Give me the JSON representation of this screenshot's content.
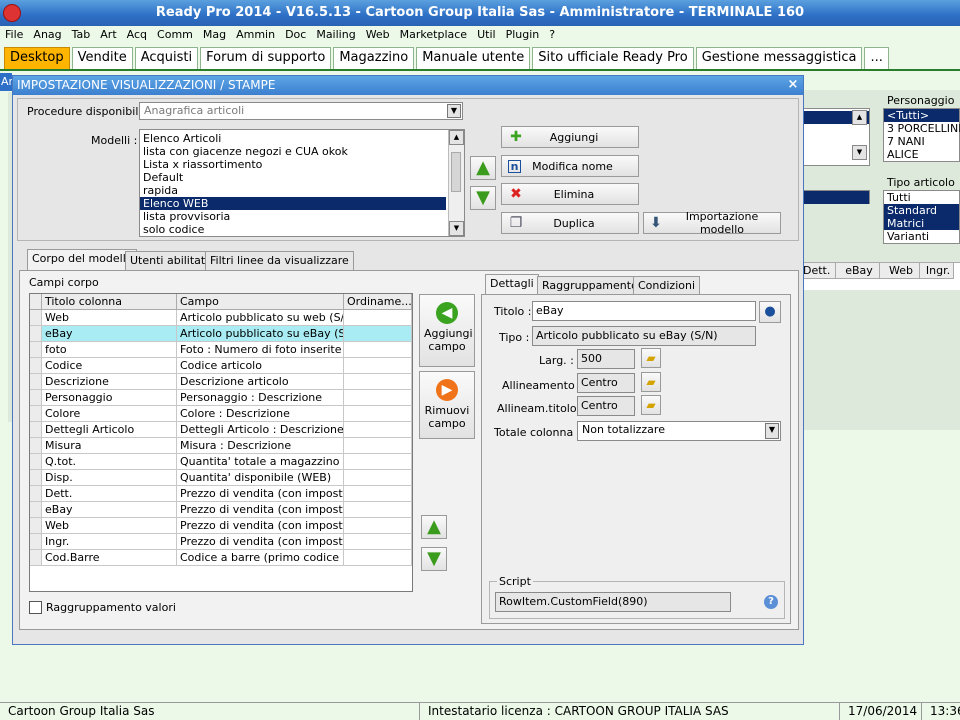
{
  "window": {
    "title": "Ready Pro 2014 - V16.5.13 - Cartoon Group Italia Sas - Amministratore - TERMINALE 160"
  },
  "menu": [
    "File",
    "Anag",
    "Tab",
    "Art",
    "Acq",
    "Comm",
    "Mag",
    "Ammin",
    "Doc",
    "Mailing",
    "Web",
    "Marketplace",
    "Util",
    "Plugin",
    "?"
  ],
  "tabs": [
    "Desktop",
    "Vendite",
    "Acquisti",
    "Forum di supporto",
    "Magazzino",
    "Manuale utente",
    "Sito ufficiale Ready Pro",
    "Gestione messaggistica",
    "..."
  ],
  "background": {
    "strip_label": "Ar",
    "personaggio": {
      "label": "Personaggio",
      "items": [
        "<Tutti>",
        "3 PORCELLINI",
        "7 NANI",
        "ALICE"
      ]
    },
    "tipo_articolo": {
      "label": "Tipo articolo",
      "items": [
        "Tutti",
        "Standard",
        "Matrici",
        "Varianti"
      ]
    },
    "grid_headers": [
      "Dett.",
      "eBay",
      "Web",
      "Ingr."
    ]
  },
  "dialog": {
    "title": "IMPOSTAZIONE VISUALIZZAZIONI / STAMPE",
    "close": "×",
    "procedure_label": "Procedure disponibili :",
    "procedure_value": "Anagrafica articoli",
    "modelli_label": "Modelli :",
    "modelli": [
      "Elenco Articoli",
      "lista con giacenze negozi e CUA okok",
      "Lista x riassortimento",
      "Default",
      "rapida",
      "Elenco WEB",
      "lista provvisoria",
      "solo codice"
    ],
    "buttons": {
      "aggiungi": "Aggiungi",
      "modifica": "Modifica nome",
      "elimina": "Elimina",
      "duplica": "Duplica",
      "importazione": "Importazione modello"
    },
    "tabs": [
      "Corpo del modello",
      "Utenti abilitati",
      "Filtri linee da visualizzare"
    ],
    "campi_label": "Campi corpo",
    "columns": [
      "Titolo colonna",
      "Campo",
      "Ordiname..."
    ],
    "rows": [
      [
        "Web",
        "Articolo pubblicato su web (S/N)"
      ],
      [
        "eBay",
        "Articolo pubblicato su eBay (S/N)"
      ],
      [
        "foto",
        "Foto : Numero di foto inserite ..."
      ],
      [
        "Codice",
        "Codice articolo"
      ],
      [
        "Descrizione",
        "Descrizione articolo"
      ],
      [
        "Personaggio",
        "Personaggio : Descrizione"
      ],
      [
        "Colore",
        "Colore : Descrizione"
      ],
      [
        "Dettegli Articolo",
        "Dettegli Articolo : Descrizione"
      ],
      [
        "Misura",
        "Misura : Descrizione"
      ],
      [
        "Q.tot.",
        "Quantita' totale a magazzino"
      ],
      [
        "Disp.",
        "Quantita' disponibile (WEB)"
      ],
      [
        "Dett.",
        "Prezzo di vendita (con imposte)"
      ],
      [
        "eBay",
        "Prezzo di vendita (con imposte)"
      ],
      [
        "Web",
        "Prezzo di vendita (con imposte)"
      ],
      [
        "Ingr.",
        "Prezzo di vendita (con imposte)"
      ],
      [
        "Cod.Barre",
        "Codice a barre (primo codice a ..."
      ]
    ],
    "aggiungi_campo": "Aggiungi campo",
    "rimuovi_campo": "Rimuovi campo",
    "raggruppamento_valori": "Raggruppamento valori",
    "detail_tabs": [
      "Dettagli",
      "Raggruppamento",
      "Condizioni"
    ],
    "detail": {
      "titolo_label": "Titolo :",
      "titolo_value": "eBay",
      "tipo_label": "Tipo :",
      "tipo_value": "Articolo pubblicato su eBay (S/N)",
      "larg_label": "Larg. :",
      "larg_value": "500",
      "allineamento_label": "Allineamento :",
      "allineamento_value": "Centro",
      "allineam_titolo_label": "Allineam.titolo :",
      "allineam_titolo_value": "Centro",
      "totale_label": "Totale colonna :",
      "totale_value": "Non totalizzare",
      "script_label": "Script",
      "script_value": "RowItem.CustomField(890)"
    }
  },
  "status": {
    "company": "Cartoon Group Italia Sas",
    "license": "Intestatario licenza : CARTOON GROUP ITALIA SAS",
    "date": "17/06/2014",
    "time": "13:36"
  }
}
